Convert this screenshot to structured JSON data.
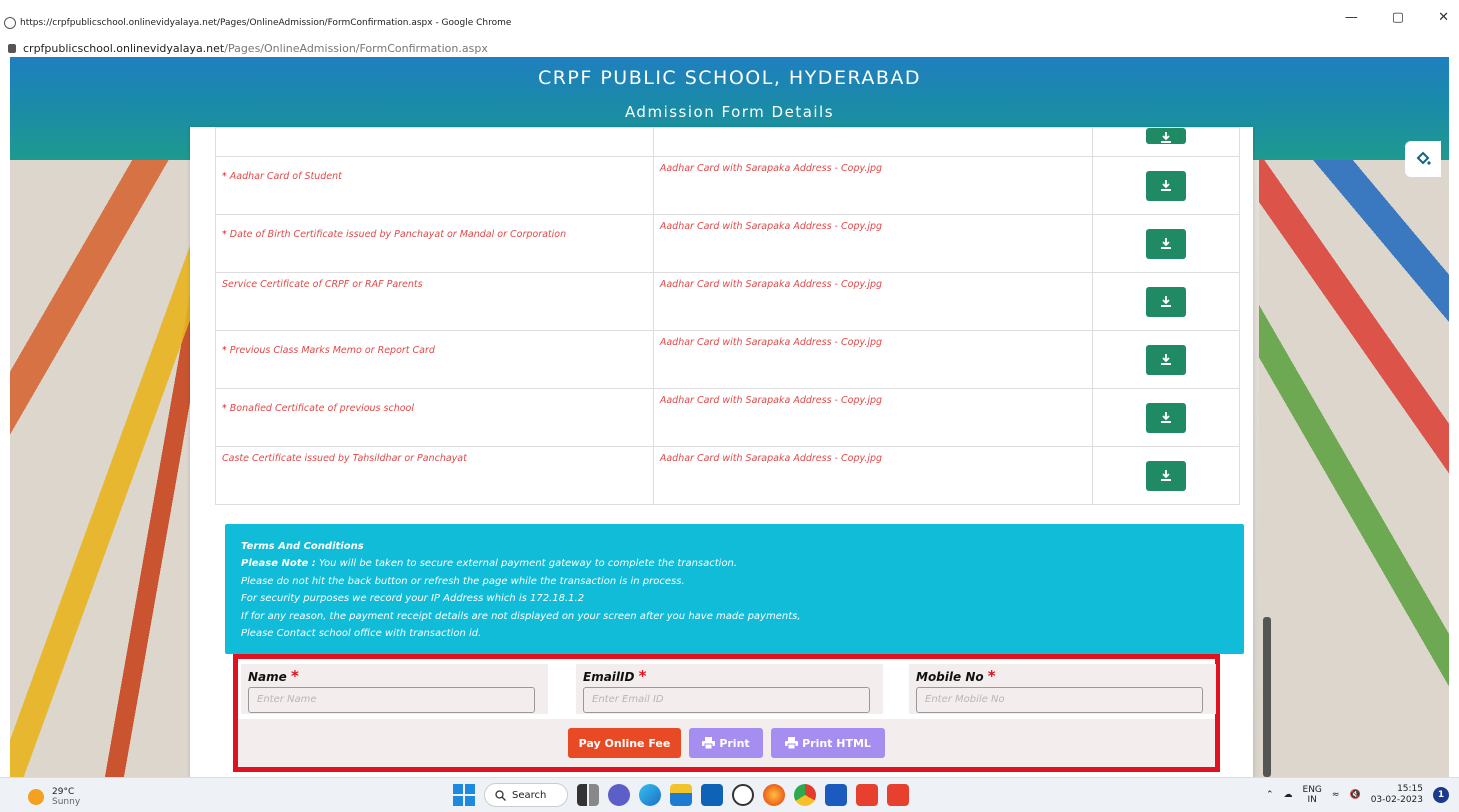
{
  "browser": {
    "window_title": "https://crpfpublicschool.onlinevidyalaya.net/Pages/OnlineAdmission/FormConfirmation.aspx - Google Chrome",
    "url_host": "crpfpublicschool.onlinevidyalaya.net",
    "url_path": "/Pages/OnlineAdmission/FormConfirmation.aspx",
    "controls": {
      "minimize": "—",
      "restore": "▢",
      "close": "✕"
    }
  },
  "header": {
    "school_name": "CRPF PUBLIC SCHOOL, HYDERABAD",
    "subtitle": "Admission Form Details"
  },
  "documents": [
    {
      "required": false,
      "name": "",
      "file": ""
    },
    {
      "required": true,
      "name": "Aadhar Card of Student",
      "file": "Aadhar Card with Sarapaka Address - Copy.jpg"
    },
    {
      "required": true,
      "name": "Date of Birth Certificate issued by Panchayat or Mandal or Corporation",
      "file": "Aadhar Card with Sarapaka Address - Copy.jpg"
    },
    {
      "required": false,
      "name": "Service Certificate of CRPF or RAF Parents",
      "file": "Aadhar Card with Sarapaka Address - Copy.jpg"
    },
    {
      "required": true,
      "name": "Previous Class Marks Memo or Report Card",
      "file": "Aadhar Card with Sarapaka Address - Copy.jpg"
    },
    {
      "required": true,
      "name": "Bonafied Certificate of previous school",
      "file": "Aadhar Card with Sarapaka Address - Copy.jpg"
    },
    {
      "required": false,
      "name": "Caste Certificate issued by Tahsildhar or Panchayat",
      "file": "Aadhar Card with Sarapaka Address - Copy.jpg"
    }
  ],
  "required_marker": "*",
  "terms": {
    "title": "Terms And Conditions",
    "note_label": "Please Note :",
    "note_text": " You will be taken to secure external payment gateway to complete the transaction.",
    "line2": "Please do not hit the back button or refresh the page while the transaction is in process.",
    "line3": "For security purposes we record your IP Address which is 172.18.1.2",
    "line4": "If for any reason, the payment receipt details are not displayed on your screen after you have made payments,",
    "line5": "Please Contact school office with transaction id."
  },
  "form": {
    "name_label": "Name",
    "name_placeholder": "Enter Name",
    "email_label": "EmailID",
    "email_placeholder": "Enter Email ID",
    "mobile_label": "Mobile No",
    "mobile_placeholder": "Enter Mobile No",
    "pay_button": "Pay Online Fee",
    "print_button": "Print",
    "print_html_button": "Print HTML"
  },
  "taskbar": {
    "temperature": "29°C",
    "weather": "Sunny",
    "search_label": "Search",
    "lang_top": "ENG",
    "lang_bottom": "IN",
    "time": "15:15",
    "date": "03-02-2023",
    "notification_count": "1"
  },
  "colors": {
    "header": "#1a8aa9",
    "terms_bg": "#10bcd7",
    "download_btn": "#1f8a63",
    "pay_btn": "#e84a26",
    "print_btn": "#a68df0",
    "highlight_border": "#e0121f"
  }
}
